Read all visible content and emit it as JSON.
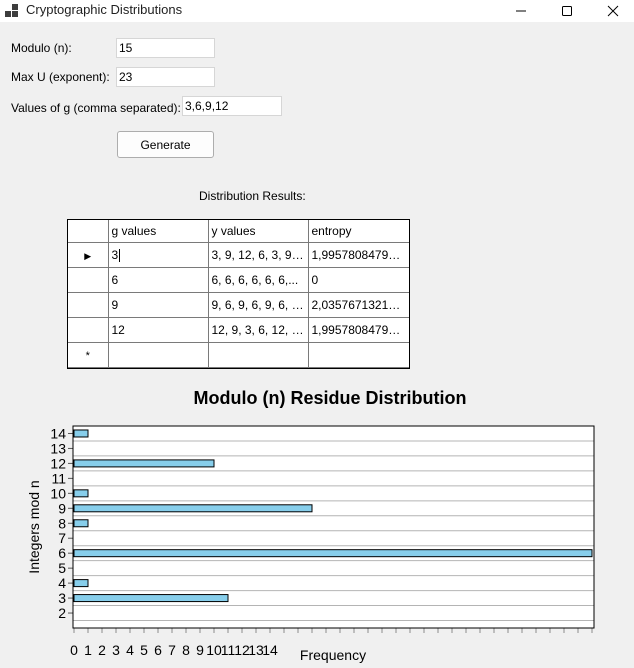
{
  "window": {
    "title": "Cryptographic Distributions",
    "controls": [
      "minimize",
      "maximize",
      "close"
    ]
  },
  "form": {
    "modulo_label": "Modulo (n):",
    "modulo_value": "15",
    "maxu_label": "Max U (exponent):",
    "maxu_value": "23",
    "g_label": "Values of g (comma separated):",
    "g_value": "3,6,9,12",
    "generate_label": "Generate",
    "results_label": "Distribution Results:"
  },
  "grid": {
    "columns": [
      "g values",
      "y values",
      "entropy"
    ],
    "rows": [
      {
        "g": "3",
        "y": "3, 9, 12, 6, 3, 9, ...",
        "entropy": "1,995780847908..."
      },
      {
        "g": "6",
        "y": "6, 6, 6, 6, 6, 6,...",
        "entropy": "0"
      },
      {
        "g": "9",
        "y": "9, 6, 9, 6, 9, 6, 9,...",
        "entropy": "2,035767132192..."
      },
      {
        "g": "12",
        "y": "12, 9, 3, 6, 12, 9,...",
        "entropy": "1,995780847908..."
      }
    ],
    "current_row_marker": "▶",
    "new_row_marker": "*"
  },
  "chart_data": {
    "type": "bar",
    "orientation": "horizontal",
    "title": "Modulo (n) Residue Distribution",
    "xlabel": "Frequency",
    "ylabel": "Integers mod n",
    "categories": [
      "2",
      "3",
      "4",
      "5",
      "6",
      "7",
      "8",
      "9",
      "10",
      "11",
      "12",
      "13",
      "14"
    ],
    "values": [
      0,
      11,
      1,
      0,
      37,
      0,
      1,
      17,
      1,
      0,
      10,
      0,
      1
    ],
    "x_tick_labels": [
      "0",
      "1",
      "2",
      "3",
      "4",
      "5",
      "6",
      "7",
      "8",
      "9",
      "10",
      "11",
      "12",
      "13",
      "14"
    ],
    "xlim": [
      0,
      37
    ],
    "bar_color": "#87ceeb",
    "bar_edge_color": "#000000",
    "grid": true
  }
}
